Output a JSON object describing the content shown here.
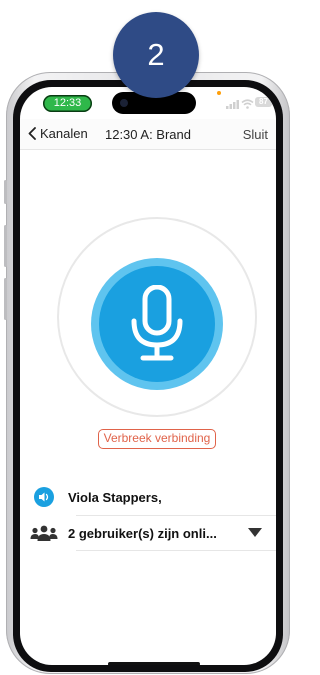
{
  "badge": {
    "number": "2"
  },
  "status_bar": {
    "time": "12:33",
    "battery": "87"
  },
  "nav": {
    "back_label": "Kanalen",
    "title": "12:30 A: Brand",
    "close_label": "Sluit"
  },
  "actions": {
    "disconnect_label": "Verbreek verbinding"
  },
  "speaker_row": {
    "text": "Viola Stappers,"
  },
  "users_row": {
    "text": "2 gebruiker(s) zijn onli..."
  },
  "colors": {
    "accent_blue": "#1aa0e0",
    "badge_navy": "#2f4b86",
    "danger": "#e0634a",
    "status_green": "#2fb84a"
  },
  "icons": [
    "chevron-left-icon",
    "microphone-icon",
    "speaker-icon",
    "users-icon",
    "caret-down-icon",
    "signal-icon",
    "wifi-icon"
  ]
}
